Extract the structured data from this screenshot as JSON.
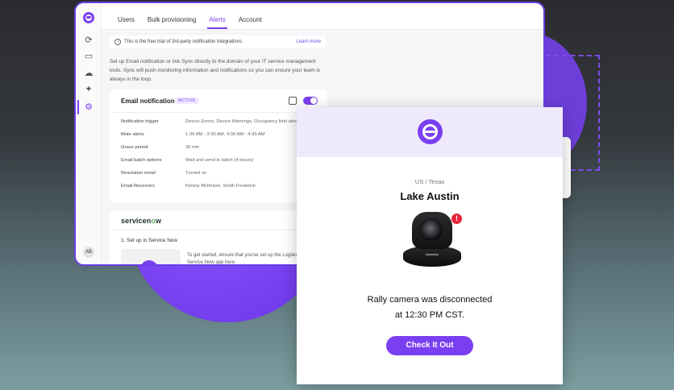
{
  "tabs": [
    "Users",
    "Bulk provisioning",
    "Alerts",
    "Account"
  ],
  "notice": {
    "text": "This is the free trial of 3rd-party notification integrations",
    "link": "Learn more"
  },
  "description": "Set up Email notification or link Sync directly to the domain of your IT service management tools. Sync will push monitoring information and notifications so you can ensure your team is always in the loop.",
  "email_card": {
    "title": "Email notification",
    "badge": "ACTIVE",
    "rows": [
      {
        "key": "Notification trigger",
        "value": "Device Errors, Device Warnings, Occupancy limit alerts"
      },
      {
        "key": "Mute alerts",
        "value": "1:30 AM - 3:30 AM, 4:00 AM - 4:30 AM"
      },
      {
        "key": "Grace period",
        "value": "30 min"
      },
      {
        "key": "Email batch options",
        "value": "Wait and send in batch (4 Hours)"
      },
      {
        "key": "Resolution email",
        "value": "Turned on"
      },
      {
        "key": "Email Receivers",
        "value": "Kimmy McIlmore, Smith Frederick"
      }
    ]
  },
  "servicenow": {
    "logo_pre": "servicen",
    "logo_o": "o",
    "logo_post": "w",
    "step": "1. Set up in Service Now",
    "text": "To get started, ensure that you've set up the Logitech Sync Service Now app here.",
    "thumb_text": "lo"
  },
  "avatar_initials": "AB",
  "alert": {
    "location": "US / Texas",
    "room": "Lake Austin",
    "message_line1": "Rally camera was disconnected",
    "message_line2": "at 12:30 PM CST.",
    "cta": "Check It Out"
  },
  "colors": {
    "accent": "#7b3ff2",
    "warning": "#e8243a",
    "success": "#5aa58a"
  },
  "icons": [
    "app-logo-icon",
    "sync-icon",
    "tablet-icon",
    "cloud-icon",
    "bulb-icon",
    "gear-icon",
    "info-icon",
    "edit-icon",
    "user-icon",
    "mail-icon",
    "warning-icon"
  ]
}
